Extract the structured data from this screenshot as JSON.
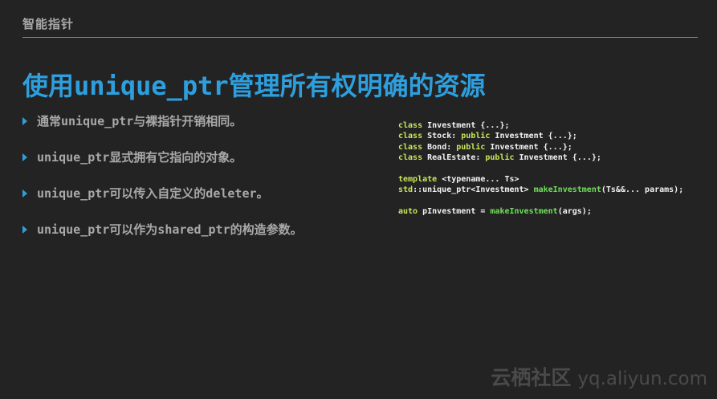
{
  "header": {
    "section_title": "智能指针"
  },
  "title": {
    "prefix": "使用",
    "code": "unique_ptr",
    "suffix": "管理所有权明确的资源"
  },
  "bullets": [
    "通常unique_ptr与裸指针开销相同。",
    "unique_ptr显式拥有它指向的对象。",
    "unique_ptr可以传入自定义的deleter。",
    "unique_ptr可以作为shared_ptr的构造参数。"
  ],
  "code": {
    "line1_kw": "class",
    "line1_rest": " Investment {...};",
    "line2_kw": "class",
    "line2_mid": " Stock: ",
    "line2_kw2": "public",
    "line2_rest": " Investment {...};",
    "line3_kw": "class",
    "line3_mid": " Bond: ",
    "line3_kw2": "public",
    "line3_rest": " Investment {...};",
    "line4_kw": "class",
    "line4_mid": " RealEstate: ",
    "line4_kw2": "public",
    "line4_rest": " Investment {...};",
    "line5_kw": "template",
    "line5_rest": " <typename... Ts>",
    "line6_kw": "std",
    "line6_mid": "::unique_ptr<Investment> ",
    "line6_fn": "makeInvestment",
    "line6_rest": "(Ts&&... params);",
    "line7_kw": "auto",
    "line7_mid": " pInvestment = ",
    "line7_fn": "makeInvestment",
    "line7_rest": "(args);"
  },
  "watermark": {
    "brand": "云栖社区",
    "url": "yq.aliyun.com"
  },
  "colors": {
    "background": "#232323",
    "accent": "#2e9fde",
    "keyword": "#c8e65a",
    "function": "#6fe05a"
  }
}
